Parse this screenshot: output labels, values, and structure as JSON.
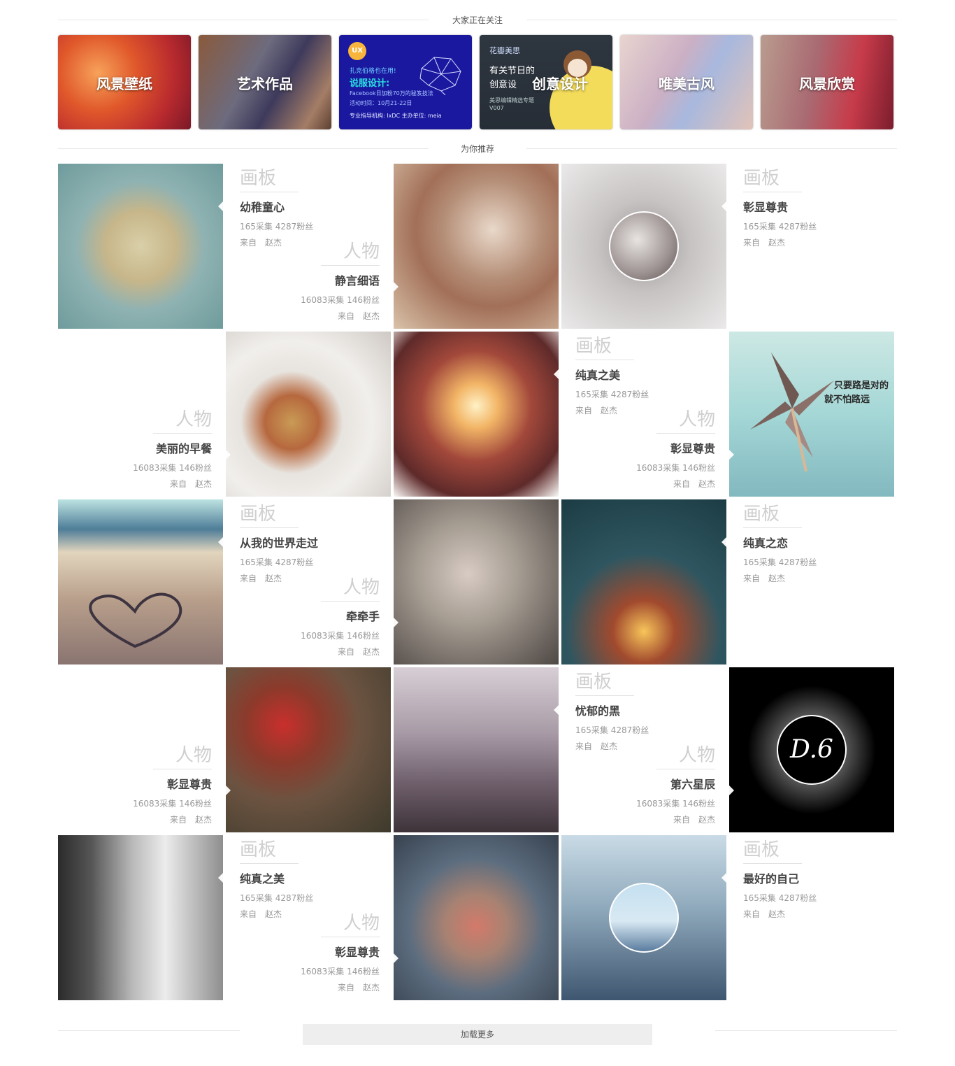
{
  "section_following": {
    "title": "大家正在关注"
  },
  "tags": [
    {
      "label": "风景壁纸"
    },
    {
      "label": "艺术作品"
    },
    {
      "label": "",
      "badge": "UX",
      "line1": "扎克伯格也在用!",
      "line2": "说服设计:",
      "line3": "Facebook日加粉70万的秘笈技法",
      "line4": "活动时间：10月21-22日",
      "footer": "专业指导机构: IxDC     主办单位: meia"
    },
    {
      "label": "创意设计",
      "brand": "花瓣美思",
      "line1": "有关节日的",
      "line2": "创意设",
      "sub1": "美思编辑精选专题",
      "sub2": "V007"
    },
    {
      "label": "唯美古风"
    },
    {
      "label": "风景欣赏"
    }
  ],
  "section_recommend": {
    "title": "为你推荐"
  },
  "rows": [
    {
      "board": {
        "kind": "画板",
        "name": "幼稚童心",
        "stats": "165采集 4287粉丝",
        "from": "来自",
        "author": "赵杰"
      },
      "person": {
        "kind": "人物",
        "name": "静言细语",
        "stats": "16083采集 146粉丝",
        "from": "来自",
        "author": "赵杰"
      },
      "board2": {
        "kind": "画板",
        "name": "彰显尊贵",
        "stats": "165采集 4287粉丝",
        "from": "来自",
        "author": "赵杰"
      }
    },
    {
      "person": {
        "kind": "人物",
        "name": "美丽的早餐",
        "stats": "16083采集 146粉丝",
        "from": "来自",
        "author": "赵杰"
      },
      "board": {
        "kind": "画板",
        "name": "纯真之美",
        "stats": "165采集 4287粉丝",
        "from": "来自",
        "author": "赵杰"
      },
      "person2": {
        "kind": "人物",
        "name": "彰显尊贵",
        "stats": "16083采集 146粉丝",
        "from": "来自",
        "author": "赵杰"
      },
      "windmill_text1": "只要路是对的",
      "windmill_text2": "就不怕路远"
    },
    {
      "board": {
        "kind": "画板",
        "name": "从我的世界走过",
        "stats": "165采集 4287粉丝",
        "from": "来自",
        "author": "赵杰"
      },
      "person": {
        "kind": "人物",
        "name": "牵牵手",
        "stats": "16083采集 146粉丝",
        "from": "来自",
        "author": "赵杰"
      },
      "board2": {
        "kind": "画板",
        "name": "纯真之恋",
        "stats": "165采集 4287粉丝",
        "from": "来自",
        "author": "赵杰"
      }
    },
    {
      "person": {
        "kind": "人物",
        "name": "彰显尊贵",
        "stats": "16083采集 146粉丝",
        "from": "来自",
        "author": "赵杰"
      },
      "board": {
        "kind": "画板",
        "name": "忧郁的黑",
        "stats": "165采集 4287粉丝",
        "from": "来自",
        "author": "赵杰"
      },
      "person2": {
        "kind": "人物",
        "name": "第六星辰",
        "stats": "16083采集 146粉丝",
        "from": "来自",
        "author": "赵杰"
      },
      "logo_text": "D.6"
    },
    {
      "board": {
        "kind": "画板",
        "name": "纯真之美",
        "stats": "165采集 4287粉丝",
        "from": "来自",
        "author": "赵杰"
      },
      "person": {
        "kind": "人物",
        "name": "彰显尊贵",
        "stats": "16083采集 146粉丝",
        "from": "来自",
        "author": "赵杰"
      },
      "board2": {
        "kind": "画板",
        "name": "最好的自己",
        "stats": "165采集 4287粉丝",
        "from": "来自",
        "author": "赵杰"
      }
    }
  ],
  "load_more": {
    "label": "加载更多"
  }
}
